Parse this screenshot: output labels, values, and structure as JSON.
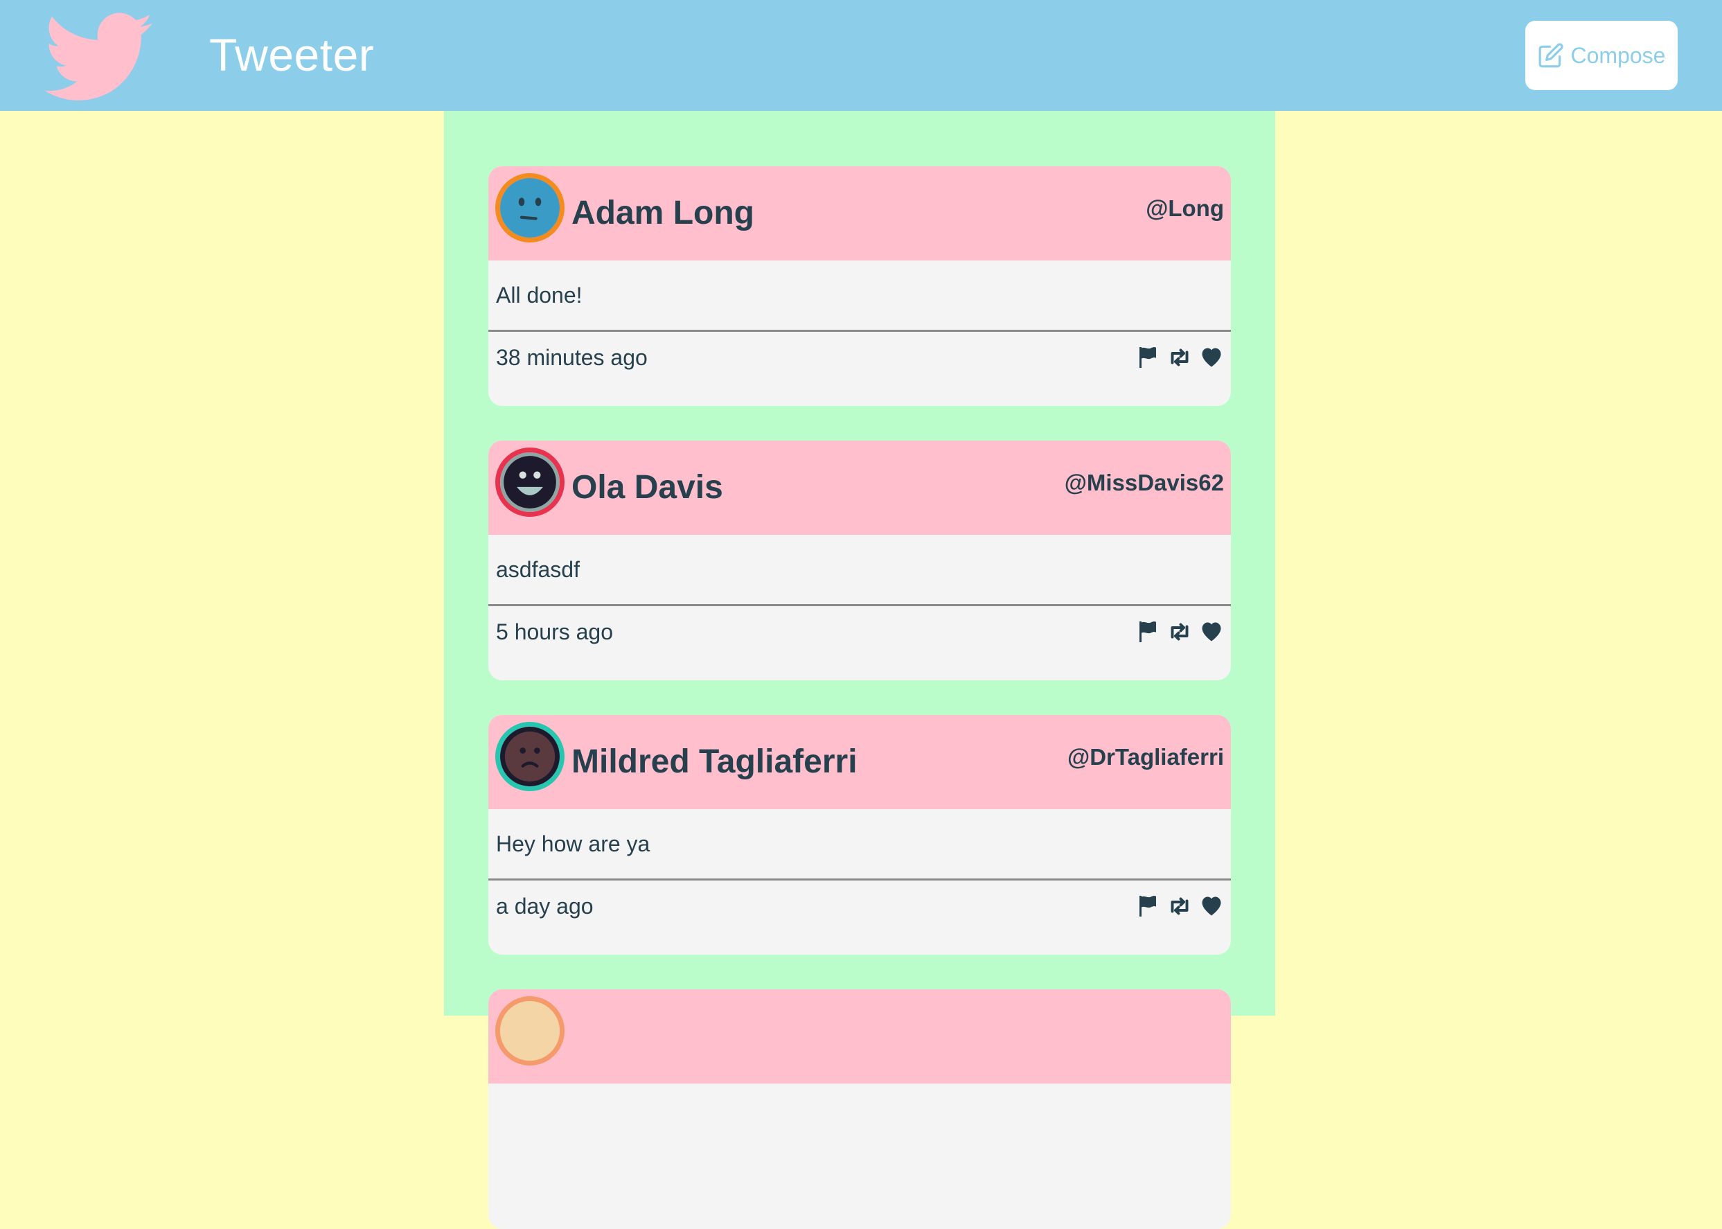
{
  "app": {
    "title": "Tweeter",
    "logo_icon": "bird-logo-icon",
    "logo_color": "#ffbfcc",
    "nav_color": "#8ccee9"
  },
  "compose": {
    "label": "Compose",
    "icon": "edit-icon"
  },
  "colors": {
    "page_background": "#fffdbb",
    "feed_background": "#bbfdca",
    "tweet_header": "#ffbfcc",
    "tweet_body": "#f4f4f4",
    "text": "#26404d"
  },
  "tweets": [
    {
      "name": "Adam Long",
      "handle": "@Long",
      "text": "All done!",
      "time": "38 minutes ago",
      "avatar_ring": "#f48b1e",
      "avatar_face": "#3a9bc6",
      "avatar_mood": "neutral"
    },
    {
      "name": "Ola Davis",
      "handle": "@MissDavis62",
      "text": "asdfasdf",
      "time": "5 hours ago",
      "avatar_ring": "#e8334f",
      "avatar_face": "#1d1a2e",
      "avatar_mood": "grin"
    },
    {
      "name": "Mildred Tagliaferri",
      "handle": "@DrTagliaferri",
      "text": "Hey how are ya",
      "time": "a day ago",
      "avatar_ring": "#26c6b0",
      "avatar_face": "#5a3a3e",
      "avatar_mood": "sad"
    },
    {
      "name": "",
      "handle": "",
      "text": "",
      "time": "",
      "avatar_ring": "#f59a6a",
      "avatar_face": "#f4d6a6",
      "avatar_mood": "neutral"
    }
  ],
  "action_icons": [
    "flag-icon",
    "retweet-icon",
    "heart-icon"
  ]
}
